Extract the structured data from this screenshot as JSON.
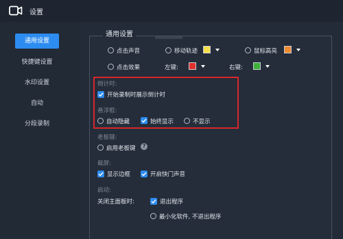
{
  "window": {
    "title": "设置"
  },
  "sidebar": {
    "items": [
      {
        "label": "通用设置",
        "active": true
      },
      {
        "label": "快捷键设置"
      },
      {
        "label": "水印设置"
      },
      {
        "label": "自动"
      },
      {
        "label": "分段录制"
      }
    ]
  },
  "general": {
    "title": "通用设置",
    "mouse_row1": [
      {
        "label": "点击声音"
      },
      {
        "label": "移动轨迹",
        "color": "#f5e04a"
      },
      {
        "label": "鼠标高亮",
        "color": "#f08a30"
      }
    ],
    "mouse_row2": {
      "click_effect": "点击效果",
      "left_label": "左键:",
      "left_color": "#e0302a",
      "right_label": "右键:",
      "right_color": "#3daf3a"
    },
    "countdown": {
      "section": "倒计时:",
      "option": "开始录制时展示倒计时"
    },
    "floating": {
      "section": "悬浮框:",
      "options": [
        "自动隐藏",
        "始终显示",
        "不显示"
      ]
    },
    "boss_key": {
      "section": "老板键:",
      "option": "启用老板键",
      "help": "?"
    },
    "screenshot": {
      "section": "截屏:",
      "options": [
        "显示边框",
        "开启快门声音"
      ]
    },
    "startup": {
      "section": "启动:",
      "close_label": "关闭主面板时:",
      "options": [
        "退出程序",
        "最小化软件, 不退出程序"
      ]
    }
  },
  "colors": {
    "accent": "#2d8cf0",
    "highlight_border": "#d9262b"
  }
}
